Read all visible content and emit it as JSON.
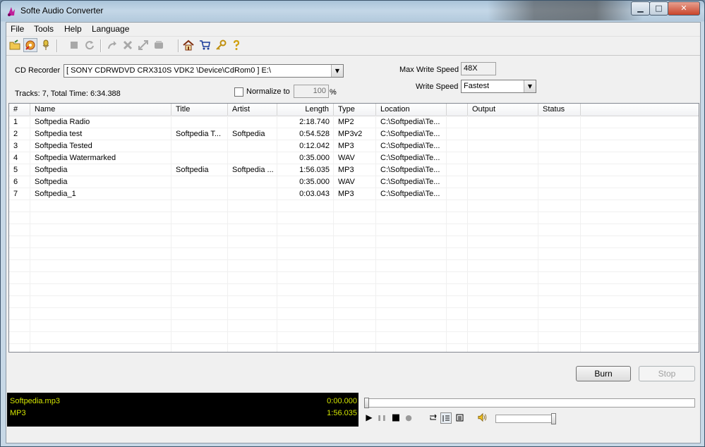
{
  "window": {
    "title": "Softe Audio Converter",
    "controls": {
      "minimize": "▁",
      "maximize": "□",
      "close": "✕"
    }
  },
  "menu": [
    "File",
    "Tools",
    "Help",
    "Language"
  ],
  "toolbar": {
    "icons": [
      "open-folder-icon",
      "add-files-icon",
      "microphone-icon",
      "stop-icon",
      "refresh-icon",
      "redo-icon",
      "delete-icon",
      "expand-icon",
      "burn-disc-icon",
      "home-icon",
      "cart-icon",
      "key-icon",
      "help-icon"
    ]
  },
  "cd": {
    "recorder_label": "CD Recorder",
    "recorder_value": "[ SONY CDRWDVD CRX310S VDK2 \\Device\\CdRom0 ] E:\\",
    "tracks_info": "Tracks: 7, Total Time: 6:34.388",
    "normalize_label": "Normalize to",
    "normalize_value": "100",
    "normalize_unit": "%",
    "max_speed_label": "Max Write Speed",
    "max_speed_value": "48X",
    "write_speed_label": "Write Speed",
    "write_speed_value": "Fastest"
  },
  "list": {
    "columns": [
      "#",
      "Name",
      "Title",
      "Artist",
      "Length",
      "Type",
      "Location",
      "",
      "Output",
      "Status"
    ],
    "rows": [
      {
        "num": "1",
        "name": "Softpedia Radio",
        "title": "",
        "artist": "",
        "length": "2:18.740",
        "type": "MP2",
        "location": "C:\\Softpedia\\Te...",
        "output": "",
        "status": ""
      },
      {
        "num": "2",
        "name": "Softpedia test",
        "title": "Softpedia T...",
        "artist": "Softpedia",
        "length": "0:54.528",
        "type": "MP3v2",
        "location": "C:\\Softpedia\\Te...",
        "output": "",
        "status": ""
      },
      {
        "num": "3",
        "name": "Softpedia Tested",
        "title": "",
        "artist": "",
        "length": "0:12.042",
        "type": "MP3",
        "location": "C:\\Softpedia\\Te...",
        "output": "",
        "status": ""
      },
      {
        "num": "4",
        "name": "Softpedia Watermarked",
        "title": "",
        "artist": "",
        "length": "0:35.000",
        "type": "WAV",
        "location": "C:\\Softpedia\\Te...",
        "output": "",
        "status": ""
      },
      {
        "num": "5",
        "name": "Softpedia",
        "title": "Softpedia",
        "artist": "Softpedia ...",
        "length": "1:56.035",
        "type": "MP3",
        "location": "C:\\Softpedia\\Te...",
        "output": "",
        "status": ""
      },
      {
        "num": "6",
        "name": "Softpedia",
        "title": "",
        "artist": "",
        "length": "0:35.000",
        "type": "WAV",
        "location": "C:\\Softpedia\\Te...",
        "output": "",
        "status": ""
      },
      {
        "num": "7",
        "name": "Softpedia_1",
        "title": "",
        "artist": "",
        "length": "0:03.043",
        "type": "MP3",
        "location": "C:\\Softpedia\\Te...",
        "output": "",
        "status": ""
      }
    ]
  },
  "buttons": {
    "burn": "Burn",
    "stop": "Stop"
  },
  "player": {
    "file": "Softpedia.mp3",
    "format": "MP3",
    "position": "0:00.000",
    "duration": "1:56.035",
    "seek_fraction": 0.0,
    "volume_fraction": 1.0,
    "text_color": "#d2e400"
  },
  "controls": {
    "play": "▶",
    "pause": "❚❚",
    "stop": "■",
    "record": "●",
    "icons": [
      "play-icon",
      "pause-icon",
      "stop-icon",
      "record-icon",
      "repeat-icon",
      "playlist-icon",
      "list-icon",
      "speaker-icon"
    ]
  }
}
